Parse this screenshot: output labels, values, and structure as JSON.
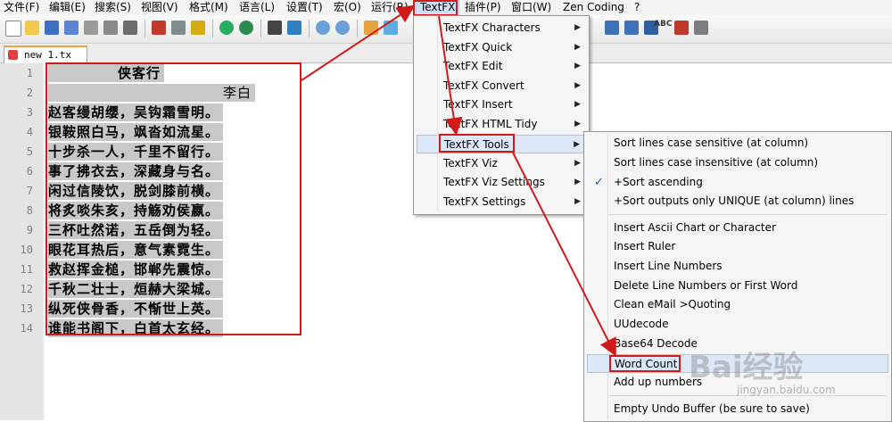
{
  "menubar": {
    "items": [
      "文件(F)",
      "编辑(E)",
      "搜索(S)",
      "视图(V)",
      "格式(M)",
      "语言(L)",
      "设置(T)",
      "宏(O)",
      "运行(R)",
      "TextFX",
      "插件(P)",
      "窗口(W)",
      "Zen Coding",
      "?"
    ]
  },
  "toolbar": {
    "spell_label": "ABC"
  },
  "tab": {
    "label": "new  1.tx"
  },
  "editor": {
    "line_numbers": [
      "1",
      "2",
      "3",
      "4",
      "5",
      "6",
      "7",
      "8",
      "9",
      "10",
      "11",
      "12",
      "13",
      "14"
    ],
    "lines": [
      "侠客行",
      "李白",
      "赵客缦胡缨，吴钩霜雪明。",
      "银鞍照白马，飒沓如流星。",
      "十步杀一人，千里不留行。",
      "事了拂衣去，深藏身与名。",
      "闲过信陵饮，脱剑膝前横。",
      "将炙啖朱亥，持觞劝侯嬴。",
      "三杯吐然诺，五岳倒为轻。",
      "眼花耳热后，意气素霓生。",
      "救赵挥金槌，邯郸先震惊。",
      "千秋二壮士，烜赫大梁城。",
      "纵死侠骨香，不惭世上英。",
      "谁能书阁下，白首太玄经。"
    ]
  },
  "textfx_menu": {
    "items": [
      {
        "label": "TextFX Characters"
      },
      {
        "label": "TextFX Quick"
      },
      {
        "label": "TextFX Edit"
      },
      {
        "label": "TextFX Convert"
      },
      {
        "label": "TextFX Insert"
      },
      {
        "label": "TextFX HTML Tidy"
      },
      {
        "label": "TextFX Tools"
      },
      {
        "label": "TextFX Viz"
      },
      {
        "label": "TextFX Viz Settings"
      },
      {
        "label": "TextFX Settings"
      }
    ]
  },
  "tools_menu": {
    "items": [
      {
        "label": "Sort lines case sensitive (at column)"
      },
      {
        "label": "Sort lines case insensitive (at column)"
      },
      {
        "label": "+Sort ascending"
      },
      {
        "label": "+Sort outputs only UNIQUE (at column) lines"
      },
      {
        "label": "Insert Ascii Chart or Character"
      },
      {
        "label": "Insert Ruler"
      },
      {
        "label": "Insert Line Numbers"
      },
      {
        "label": "Delete Line Numbers or First Word"
      },
      {
        "label": "Clean eMail >Quoting"
      },
      {
        "label": "UUdecode"
      },
      {
        "label": "Base64 Decode"
      },
      {
        "label": "Word Count"
      },
      {
        "label": "Add up numbers"
      },
      {
        "label": "Empty Undo Buffer (be sure to save)"
      }
    ],
    "check_mark": "✓"
  },
  "watermark": {
    "brand": "Bai经验",
    "url": "jingyan.baidu.com"
  },
  "colors": {
    "highlight": "#d11b1b",
    "selection": "#c8c8c8",
    "menu_hover": "#dce8f8"
  }
}
